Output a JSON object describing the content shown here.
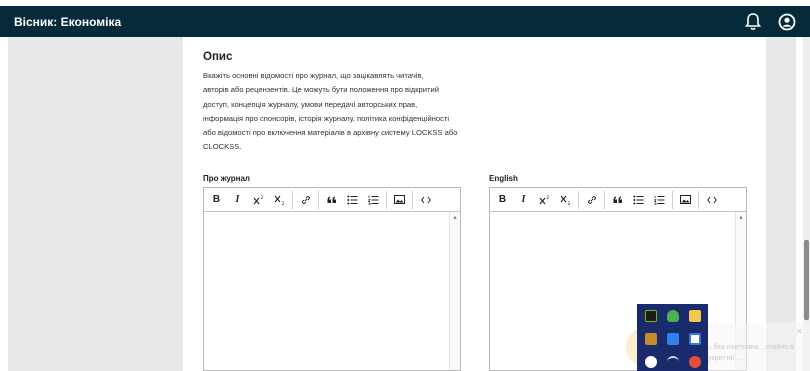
{
  "header": {
    "title": "Вісник: Економіка",
    "notifications_icon": "bell-icon",
    "user_icon": "user-account-icon"
  },
  "section": {
    "title": "Опис",
    "description_lines": [
      "Вкажіть основні відомості про журнал, що зацікавлять читачів,",
      "авторів або рецензентів. Це можуть бути положення про відкритий",
      "доступ, концепція журналу, умови передачі авторських прав,",
      "інформація про спонсорів, історія журналу, політика конфіденційності",
      "або відомості про включення матеріалів в архівну систему LOCKSS або",
      "CLOCKSS."
    ]
  },
  "editors": [
    {
      "label": "Про журнал",
      "content": ""
    },
    {
      "label": "English",
      "content": ""
    }
  ],
  "toolbar": {
    "bold": "B",
    "italic": "I",
    "buttons": [
      "bold-icon",
      "italic-icon",
      "superscript-icon",
      "subscript-icon",
      "link-icon",
      "blockquote-icon",
      "bullet-list-icon",
      "numbered-list-icon",
      "image-icon",
      "code-icon"
    ]
  },
  "notification": {
    "text": "...бка повітряна ...егайно в укриття! ..."
  },
  "colors": {
    "header_bg": "#052a3a",
    "page_bg": "#e8e8e8",
    "tray_bg": "#1a2b6d"
  }
}
